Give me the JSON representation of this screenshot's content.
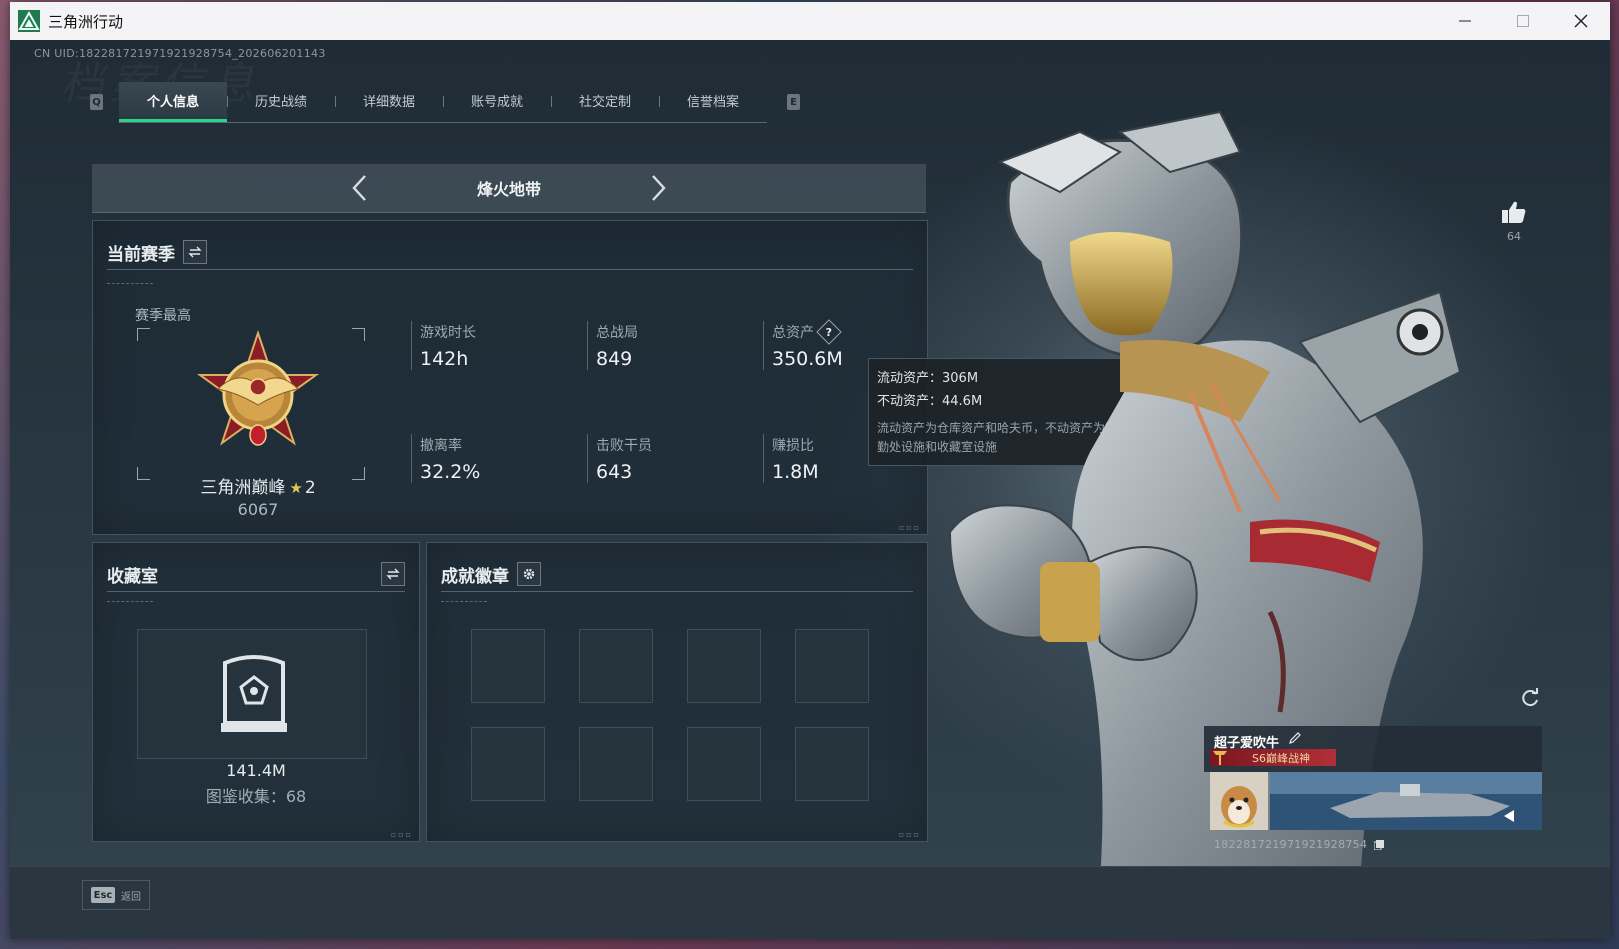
{
  "window": {
    "title": "三角洲行动"
  },
  "header": {
    "uid_line": "CN UID:182281721971921928754_202606201143",
    "watermark": "档案信息",
    "prev_key": "Q",
    "next_key": "E"
  },
  "tabs": [
    {
      "label": "个人信息",
      "active": true
    },
    {
      "label": "历史战绩",
      "active": false
    },
    {
      "label": "详细数据",
      "active": false
    },
    {
      "label": "账号成就",
      "active": false
    },
    {
      "label": "社交定制",
      "active": false
    },
    {
      "label": "信誉档案",
      "active": false
    }
  ],
  "mode": {
    "title": "烽火地带"
  },
  "season": {
    "title": "当前赛季",
    "best_label": "赛季最高",
    "rank_name": "三角洲巅峰",
    "rank_star_level": "2",
    "rank_score": "6067",
    "stats": [
      {
        "label": "游戏时长",
        "value": "142h"
      },
      {
        "label": "总战局",
        "value": "849"
      },
      {
        "label": "总资产",
        "value": "350.6M",
        "has_help": true
      },
      {
        "label": "撤离率",
        "value": "32.2%"
      },
      {
        "label": "击败干员",
        "value": "643"
      },
      {
        "label": "赚损比",
        "value": "1.8M"
      }
    ]
  },
  "tooltip": {
    "line1": "流动资产：306M",
    "line2": "不动资产：44.6M",
    "note": "流动资产为仓库资产和哈夫币，不动资产为特勤处设施和收藏室设施"
  },
  "collection": {
    "title": "收藏室",
    "value": "141.4M",
    "count_line": "图鉴收集：68"
  },
  "achievements": {
    "title": "成就徽章",
    "slot_count": 8
  },
  "like": {
    "count": "64"
  },
  "player_card": {
    "name": "超子爱吹牛",
    "title_tag": "S6巅峰战神",
    "uid": "182281721971921928754"
  },
  "footer": {
    "esc_key": "Esc",
    "esc_label": "返回"
  },
  "colors": {
    "accent": "#2bd48a",
    "panel_bg": "#1e2c36",
    "title_tag": "#b03038"
  }
}
